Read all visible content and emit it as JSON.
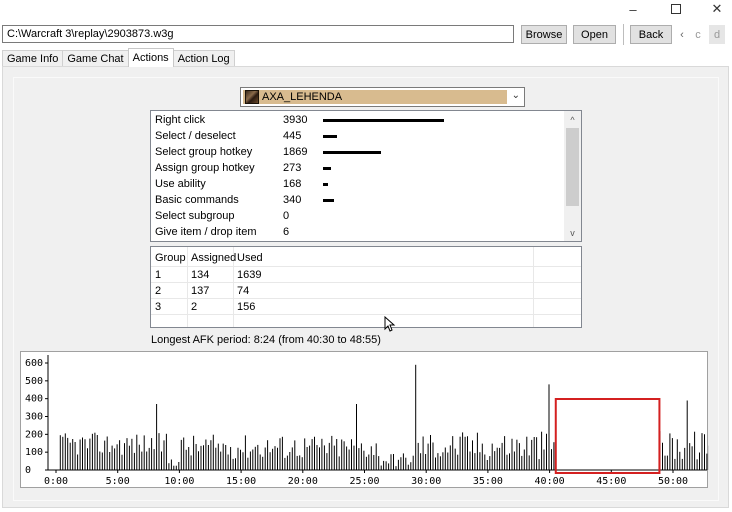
{
  "window": {
    "controls": {
      "minimize": "‒",
      "close": "✕"
    }
  },
  "toolbar": {
    "path": "C:\\Warcraft 3\\replay\\2903873.w3g",
    "browse_label": "Browse",
    "open_label": "Open",
    "back_label": "Back",
    "prev_label": "‹",
    "c_label": "c",
    "d_label": "d"
  },
  "tabs": [
    {
      "label": "Game Info"
    },
    {
      "label": "Game Chat"
    },
    {
      "label": "Actions",
      "active": true
    },
    {
      "label": "Action Log"
    }
  ],
  "player_select": {
    "selected": "AXA_LEHENDA",
    "icon": "player-portrait-icon",
    "highlight_color": "#d8bb8f"
  },
  "actions": [
    {
      "name": "Right click",
      "value": "3930",
      "bar_fraction": 1.0
    },
    {
      "name": "Select / deselect",
      "value": "445",
      "bar_fraction": 0.113
    },
    {
      "name": "Select group hotkey",
      "value": "1869",
      "bar_fraction": 0.476
    },
    {
      "name": "Assign group hotkey",
      "value": "273",
      "bar_fraction": 0.069
    },
    {
      "name": "Use ability",
      "value": "168",
      "bar_fraction": 0.043
    },
    {
      "name": "Basic commands",
      "value": "340",
      "bar_fraction": 0.087
    },
    {
      "name": "Select subgroup",
      "value": "0",
      "bar_fraction": 0
    },
    {
      "name": "Give item / drop item",
      "value": "6",
      "bar_fraction": 0.002
    }
  ],
  "scroll": {
    "up": "^",
    "down": "v"
  },
  "groups": {
    "columns": [
      "Group",
      "Assigned",
      "Used"
    ],
    "rows": [
      [
        "1",
        "134",
        "1639"
      ],
      [
        "2",
        "137",
        "74"
      ],
      [
        "3",
        "2",
        "156"
      ]
    ]
  },
  "afk_text": "Longest AFK period: 8:24 (from 40:30 to 48:55)",
  "chart_data": {
    "type": "bar",
    "title": "",
    "xlabel": "",
    "ylabel": "",
    "y_ticks": [
      "600",
      "500",
      "400",
      "300",
      "200",
      "100",
      "0"
    ],
    "x_ticks": [
      "0:00",
      "5:00",
      "10:00",
      "15:00",
      "20:00",
      "25:00",
      "30:00",
      "35:00",
      "40:00",
      "45:00",
      "50:00"
    ],
    "ylim": [
      0,
      620
    ],
    "xlim_minutes": [
      0,
      54
    ],
    "bar_color": "#000000",
    "afk_highlight": {
      "from_minutes": 40.5,
      "to_minutes": 48.9,
      "color": "#d42020"
    },
    "peaks": [
      {
        "minute": 29.2,
        "value": 590
      },
      {
        "minute": 24.3,
        "value": 370
      },
      {
        "minute": 39.9,
        "value": 480
      },
      {
        "minute": 51.2,
        "value": 390
      },
      {
        "minute": 8.1,
        "value": 370
      }
    ]
  }
}
